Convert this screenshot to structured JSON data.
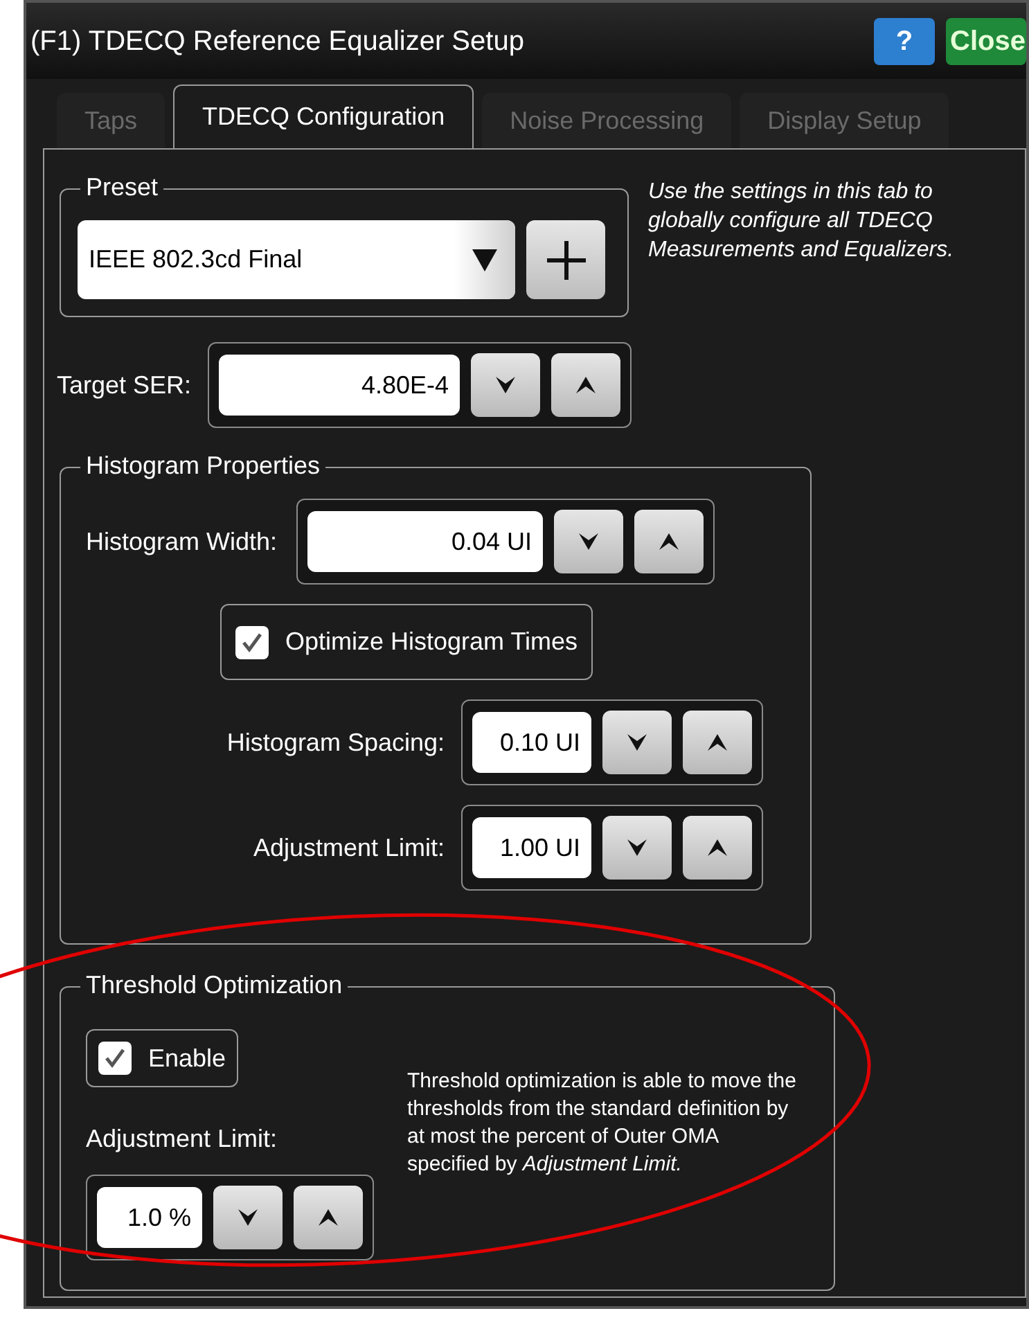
{
  "window": {
    "title": "(F1) TDECQ Reference Equalizer Setup"
  },
  "header_buttons": [
    {
      "kind": "help",
      "label": "?"
    },
    {
      "kind": "close",
      "label": "Close"
    }
  ],
  "tabs": [
    {
      "label": "Taps",
      "selected": false
    },
    {
      "label": "TDECQ Configuration",
      "selected": true
    },
    {
      "label": "Noise Processing",
      "selected": false
    },
    {
      "label": "Display Setup",
      "selected": false
    }
  ],
  "preset": {
    "title": "Preset",
    "value": "IEEE 802.3cd Final"
  },
  "help_text": "Use the settings in this tab to globally configure all TDECQ Measurements and Equalizers.",
  "target_ser": {
    "label": "Target SER:",
    "value": "4.80E-4"
  },
  "histogram_properties": {
    "title": "Histogram Properties",
    "width": {
      "label": "Histogram Width:",
      "value": "0.04 UI"
    },
    "optimize": {
      "label": "Optimize Histogram Times",
      "checked": true
    },
    "spacing": {
      "label": "Histogram Spacing:",
      "value": "0.10 UI"
    },
    "adjustment_limit": {
      "label": "Adjustment Limit:",
      "value": "1.00 UI"
    }
  },
  "threshold_optimization": {
    "title": "Threshold Optimization",
    "enable": {
      "label": "Enable",
      "checked": true
    },
    "adjustment_limit": {
      "label": "Adjustment Limit:",
      "value": "1.0 %"
    },
    "description": "Threshold optimization is able to move the thresholds from the standard definition by at most the percent of Outer OMA specified by *Adjustment Limit.*"
  }
}
